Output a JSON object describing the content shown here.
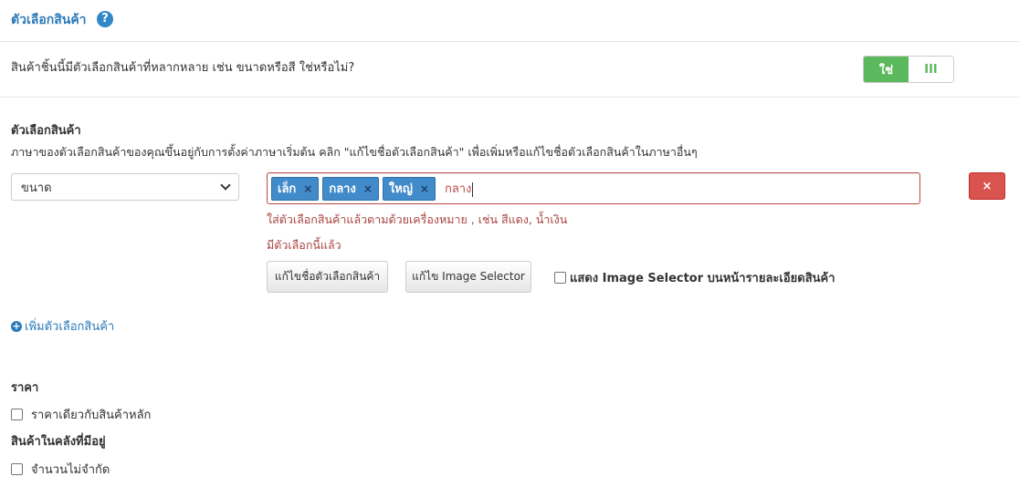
{
  "header": {
    "title": "ตัวเลือกสินค้า",
    "help_symbol": "?"
  },
  "question": {
    "text": "สินค้าชิ้นนี้มีตัวเลือกสินค้าที่หลากหลาย เช่น ขนาดหรือสี ใช่หรือไม่?",
    "toggle_yes": "ใช่",
    "toggle_no": "III",
    "selected": "ใช่",
    "accent_color": "#5cb85c"
  },
  "options": {
    "label": "ตัวเลือกสินค้า",
    "description": "ภาษาของตัวเลือกสินค้าของคุณขึ้นอยู่กับการตั้งค่าภาษาเริ่มต้น คลิก \"แก้ไขชื่อตัวเลือกสินค้า\" เพื่อเพิ่มหรือแก้ไขชื่อตัวเลือกสินค้าในภาษาอื่นๆ",
    "select_value": "ขนาด",
    "tags": [
      {
        "label": "เล็ก",
        "remove": "×"
      },
      {
        "label": "กลาง",
        "remove": "×"
      },
      {
        "label": "ใหญ่",
        "remove": "×"
      }
    ],
    "typed_value": "กลาง",
    "hint_text": "ใส่ตัวเลือกสินค้าแล้วตามด้วยเครื่องหมาย , เช่น สีแดง, น้ำเงิน",
    "error_text": "มีตัวเลือกนี้แล้ว",
    "rename_button": "แก้ไขชื่อตัวเลือกสินค้า",
    "image_selector_button": "แก้ไข Image Selector",
    "show_selector_label": "แสดง Image Selector บนหน้ารายละเอียดสินค้า",
    "delete_symbol": "×",
    "error_color": "#a94442",
    "tag_color": "#428bca",
    "delete_color": "#d9534f"
  },
  "add_option": {
    "icon": "plus-circle-icon",
    "label": "เพิ่มตัวเลือกสินค้า"
  },
  "price": {
    "label": "ราคา",
    "same_price_label": "ราคาเดียวกับสินค้าหลัก"
  },
  "stock": {
    "label": "สินค้าในคลังที่มีอยู่",
    "unlimited_label": "จำนวนไม่จำกัด"
  }
}
